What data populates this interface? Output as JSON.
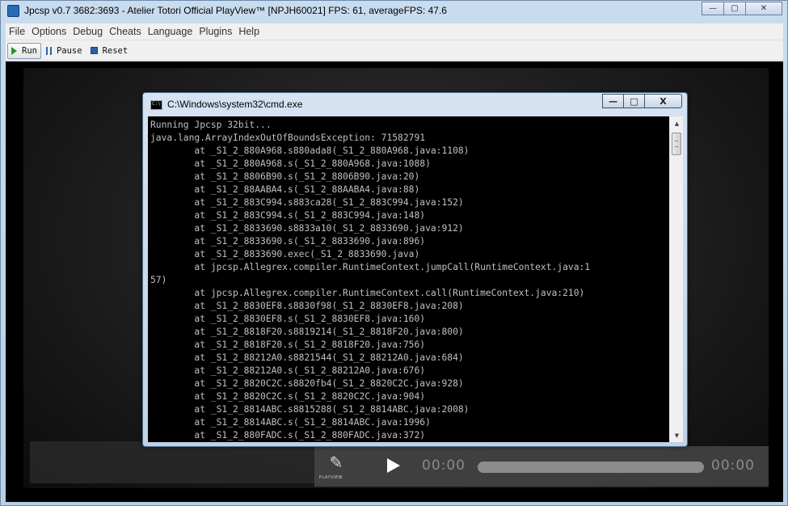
{
  "main_window": {
    "title": "Jpcsp v0.7 3682:3693 - Atelier Totori Official PlayView™ [NPJH60021] FPS: 61, averageFPS: 47.6",
    "controls": {
      "minimize": "—",
      "maximize": "▢",
      "close": "✕"
    }
  },
  "menu": [
    "File",
    "Options",
    "Debug",
    "Cheats",
    "Language",
    "Plugins",
    "Help"
  ],
  "toolbar": {
    "run": "Run",
    "pause": "Pause",
    "reset": "Reset"
  },
  "player": {
    "time_start": "00:00",
    "time_end": "00:00",
    "logo_label": "PLAYVIEW"
  },
  "cmd_window": {
    "title": "C:\\Windows\\system32\\cmd.exe",
    "controls": {
      "minimize": "—",
      "maximize": "□",
      "close": "X"
    },
    "lines": [
      "Running Jpcsp 32bit...",
      "java.lang.ArrayIndexOutOfBoundsException: 71582791",
      "        at _S1_2_880A968.s880ada8(_S1_2_880A968.java:1108)",
      "        at _S1_2_880A968.s(_S1_2_880A968.java:1088)",
      "        at _S1_2_8806B90.s(_S1_2_8806B90.java:20)",
      "        at _S1_2_88AABA4.s(_S1_2_88AABA4.java:88)",
      "        at _S1_2_883C994.s883ca28(_S1_2_883C994.java:152)",
      "        at _S1_2_883C994.s(_S1_2_883C994.java:148)",
      "        at _S1_2_8833690.s8833a10(_S1_2_8833690.java:912)",
      "        at _S1_2_8833690.s(_S1_2_8833690.java:896)",
      "        at _S1_2_8833690.exec(_S1_2_8833690.java)",
      "        at jpcsp.Allegrex.compiler.RuntimeContext.jumpCall(RuntimeContext.java:1",
      "57)",
      "        at jpcsp.Allegrex.compiler.RuntimeContext.call(RuntimeContext.java:210)",
      "        at _S1_2_8830EF8.s8830f98(_S1_2_8830EF8.java:208)",
      "        at _S1_2_8830EF8.s(_S1_2_8830EF8.java:160)",
      "        at _S1_2_8818F20.s8819214(_S1_2_8818F20.java:800)",
      "        at _S1_2_8818F20.s(_S1_2_8818F20.java:756)",
      "        at _S1_2_88212A0.s8821544(_S1_2_88212A0.java:684)",
      "        at _S1_2_88212A0.s(_S1_2_88212A0.java:676)",
      "        at _S1_2_8820C2C.s8820fb4(_S1_2_8820C2C.java:928)",
      "        at _S1_2_8820C2C.s(_S1_2_8820C2C.java:904)",
      "        at _S1_2_8814ABC.s8815288(_S1_2_8814ABC.java:2008)",
      "        at _S1_2_8814ABC.s(_S1_2_8814ABC.java:1996)",
      "        at _S1_2_880FADC.s(_S1_2_880FADC.java:372)"
    ]
  }
}
